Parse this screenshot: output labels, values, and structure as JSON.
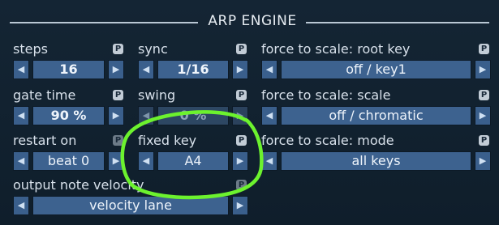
{
  "header": {
    "title": "ARP ENGINE"
  },
  "badge": "P",
  "params": {
    "steps": {
      "label": "steps",
      "value": "16"
    },
    "sync": {
      "label": "sync",
      "value": "1/16"
    },
    "root_key": {
      "label": "force to scale: root key",
      "value": "off / key1"
    },
    "gate_time": {
      "label": "gate time",
      "value": "90 %"
    },
    "swing": {
      "label": "swing",
      "value": "0 %"
    },
    "scale": {
      "label": "force to scale: scale",
      "value": "off / chromatic"
    },
    "restart_on": {
      "label": "restart on",
      "value": "beat 0"
    },
    "fixed_key": {
      "label": "fixed key",
      "value": "A4"
    },
    "mode": {
      "label": "force to scale: mode",
      "value": "all keys"
    },
    "velocity": {
      "label": "output note velocity",
      "value": "velocity lane"
    }
  },
  "icons": {
    "left": "◀",
    "right": "▶"
  },
  "colors": {
    "highlight": "#6cf22e",
    "accent": "#3d628f"
  }
}
